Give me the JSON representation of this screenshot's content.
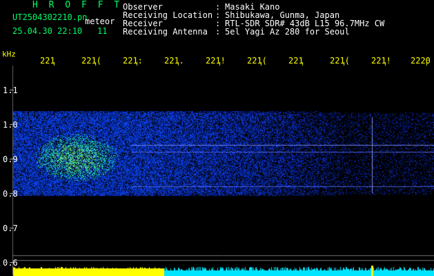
{
  "header": {
    "app_title": "H R O F F T",
    "filename": "UT2504302210.pn",
    "meteor_label": "meteor",
    "datetime": "25.04.30 22:10",
    "count": "11",
    "info": [
      {
        "label": "Observer",
        "colon": ":",
        "value": "Masaki Kano"
      },
      {
        "label": "Receiving Location",
        "colon": ":",
        "value": "Shibukawa, Gunma, Japan"
      },
      {
        "label": "Receiver",
        "colon": ":",
        "value": "RTL-SDR SDR# 43dB L15 96.7MHz CW"
      },
      {
        "label": "Receiving Antenna",
        "colon": ":",
        "value": "5el Yagi Az 280 for Seoul"
      }
    ]
  },
  "chart_data": {
    "type": "heatmap",
    "ylabel": "kHz",
    "x_tick_labels": [
      "221",
      "221(",
      "221:",
      "221.",
      "221!",
      "221(",
      "221",
      "221(",
      "221!",
      "2220"
    ],
    "y_tick_labels": [
      "1.1",
      "1.0",
      "0.9",
      "0.8",
      "0.7",
      "0.6"
    ],
    "y_ticks": [
      1.1,
      1.0,
      0.9,
      0.8,
      0.7,
      0.6
    ],
    "ylim": [
      0.6,
      1.1
    ],
    "signal_band_khz": [
      0.8,
      1.03
    ],
    "carrier_lines_khz": [
      0.94,
      0.92,
      0.82
    ],
    "bottom_strip": {
      "yellow_until_fraction": 0.36,
      "yellow": "#ffff00",
      "cyan": "#00e5ff"
    }
  },
  "colors": {
    "background": "#000000",
    "axis_text": "#ffff00",
    "title": "#00ff66",
    "info": "#ffffff",
    "noise": "#1a2cff"
  }
}
